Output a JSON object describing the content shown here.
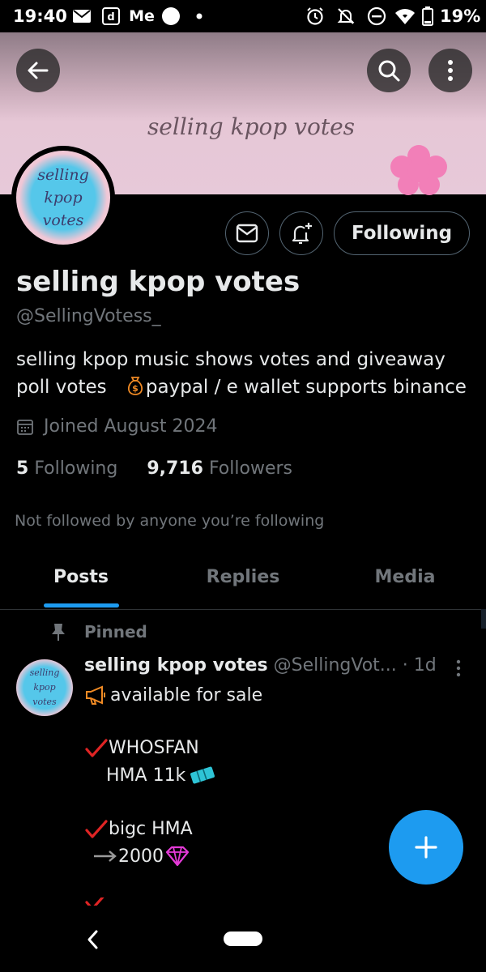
{
  "status_bar": {
    "time": "19:40",
    "carrier_text": "Me",
    "battery": "19%",
    "icons": [
      "mail-icon",
      "d-app-icon",
      "circle-icon",
      "dot-icon",
      "alarm-icon",
      "bell-off-icon",
      "dnd-icon",
      "wifi-icon",
      "battery-icon"
    ]
  },
  "banner": {
    "text": "selling kpop votes"
  },
  "profile": {
    "avatar_lines": [
      "selling",
      "kpop",
      "votes"
    ],
    "following_button": "Following",
    "name": "selling kpop votes",
    "handle": "@SellingVotess_",
    "bio_line1": "selling kpop music shows votes and giveaway",
    "bio_line2_a": "poll votes",
    "bio_line2_b": "paypal / e wallet supports  binance",
    "joined": "Joined August 2024",
    "following_count": "5",
    "following_label": "Following",
    "followers_count": "9,716",
    "followers_label": "Followers",
    "not_followed": "Not followed by anyone you’re following"
  },
  "tabs": [
    {
      "label": "Posts",
      "active": true
    },
    {
      "label": "Replies",
      "active": false
    },
    {
      "label": "Media",
      "active": false
    }
  ],
  "tweet": {
    "pinned_label": "Pinned",
    "avatar_lines": [
      "selling",
      "kpop",
      "votes"
    ],
    "name": "selling kpop votes",
    "handle": "@SellingVot...",
    "time": "· 1d",
    "lines": [
      "available for sale",
      "WHOSFAN",
      "HMA  11k",
      "bigc HMA",
      "2000"
    ]
  },
  "colors": {
    "accent": "#1d9bf0",
    "background": "#000000",
    "text_primary": "#e7e9ea",
    "text_secondary": "#71767b",
    "banner_pink": "#e7c9d9"
  }
}
